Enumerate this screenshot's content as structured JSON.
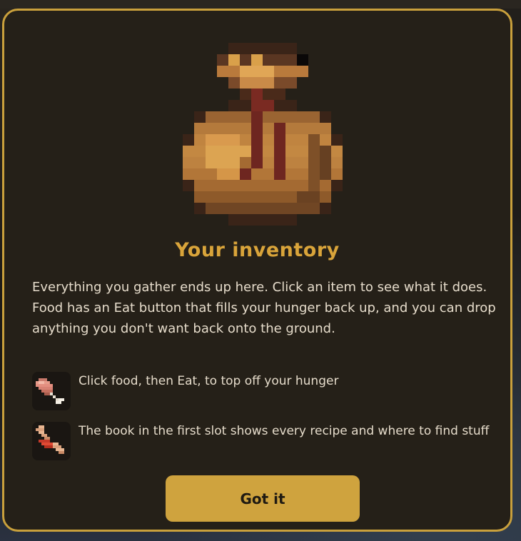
{
  "modal": {
    "title": "Your inventory",
    "description": "Everything you gather ends up here. Click an item to see what it does. Food has an Eat button that fills your hunger back up, and you can drop anything you don't want back onto the ground.",
    "tips": [
      {
        "icon": "meat-drumstick-icon",
        "text": "Click food, then Eat, to top off your hunger"
      },
      {
        "icon": "crafting-hands-icon",
        "text": "The book in the first slot shows every recipe and where to find stuff"
      }
    ],
    "button_label": "Got it"
  },
  "colors": {
    "accent": "#d9a43a",
    "button": "#cfa33e",
    "border": "#c9a03c",
    "panel": "#252018",
    "text": "#e6dccb"
  },
  "icons": {
    "hero": "inventory-bag-icon"
  }
}
